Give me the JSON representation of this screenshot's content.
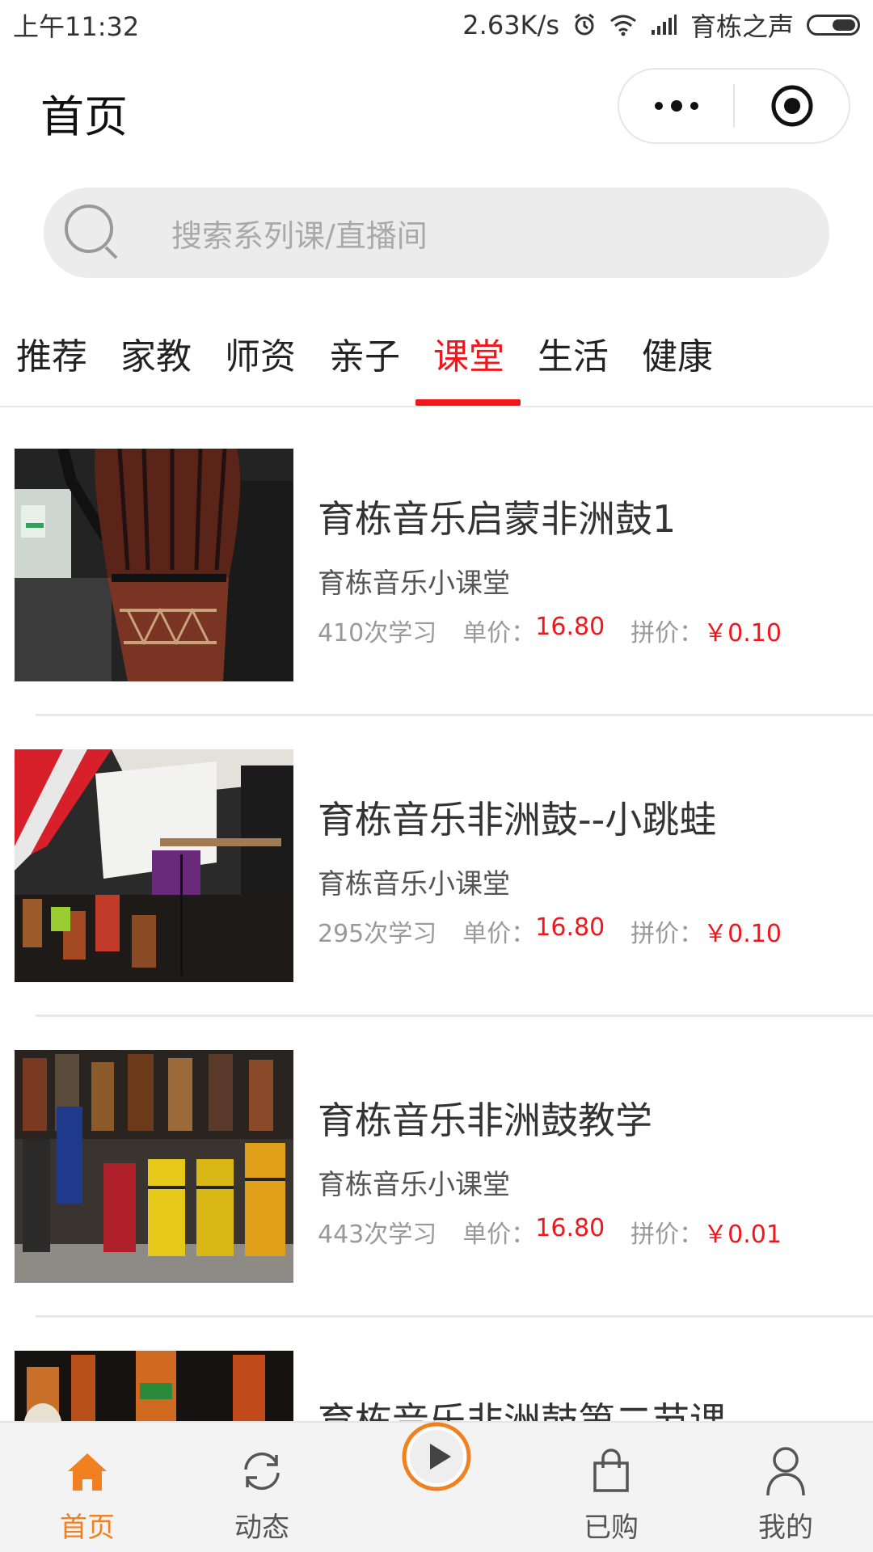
{
  "status_bar": {
    "time": "上午11:32",
    "net_speed": "2.63K/s",
    "carrier": "育栋之声"
  },
  "nav": {
    "title": "首页"
  },
  "search": {
    "placeholder": "搜索系列课/直播间"
  },
  "tabs": [
    {
      "label": "推荐",
      "active": false
    },
    {
      "label": "家教",
      "active": false
    },
    {
      "label": "师资",
      "active": false
    },
    {
      "label": "亲子",
      "active": false
    },
    {
      "label": "课堂",
      "active": true
    },
    {
      "label": "生活",
      "active": false
    },
    {
      "label": "健康",
      "active": false
    }
  ],
  "courses": [
    {
      "title": "育栋音乐启蒙非洲鼓1",
      "source": "育栋音乐小课堂",
      "learners": "410次学习",
      "unit_label": "单价：",
      "unit_price": "16.80",
      "group_label": "拼价：",
      "group_price": "￥0.10"
    },
    {
      "title": "育栋音乐非洲鼓--小跳蛙",
      "source": "育栋音乐小课堂",
      "learners": "295次学习",
      "unit_label": "单价：",
      "unit_price": "16.80",
      "group_label": "拼价：",
      "group_price": "￥0.10"
    },
    {
      "title": "育栋音乐非洲鼓教学",
      "source": "育栋音乐小课堂",
      "learners": "443次学习",
      "unit_label": "单价：",
      "unit_price": "16.80",
      "group_label": "拼价：",
      "group_price": "￥0.01"
    },
    {
      "title": "育栋音乐非洲鼓第二节课",
      "source": "",
      "learners": "",
      "unit_label": "",
      "unit_price": "",
      "group_label": "",
      "group_price": ""
    }
  ],
  "bottom_nav": [
    {
      "label": "首页",
      "icon": "home-icon",
      "active": true
    },
    {
      "label": "动态",
      "icon": "refresh-icon",
      "active": false
    },
    {
      "label": "",
      "icon": "play-icon",
      "active": false
    },
    {
      "label": "已购",
      "icon": "shopping-bag-icon",
      "active": false
    },
    {
      "label": "我的",
      "icon": "user-icon",
      "active": false
    }
  ],
  "colors": {
    "accent_red": "#f0171c",
    "accent_orange": "#f08020"
  }
}
